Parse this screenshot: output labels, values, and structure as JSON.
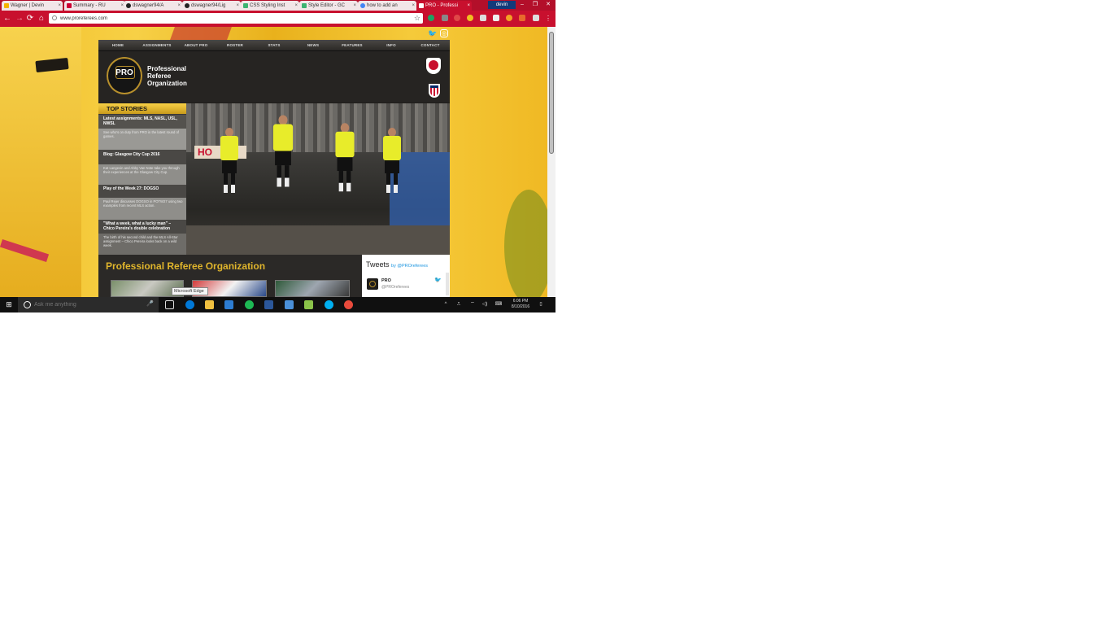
{
  "browser": {
    "tabs": [
      {
        "label": "Wagner | Devin",
        "favicon_color": "#f4b400",
        "active": false
      },
      {
        "label": "Summary - RU",
        "favicon_color": "#cc0033",
        "active": false
      },
      {
        "label": "dswagner94/A",
        "favicon_color": "#222222",
        "active": false
      },
      {
        "label": "dswagner94/Lig",
        "favicon_color": "#222222",
        "active": false
      },
      {
        "label": "CSS Styling Inst",
        "favicon_color": "#3cb371",
        "active": false
      },
      {
        "label": "Style Editor - GC",
        "favicon_color": "#3cb371",
        "active": false
      },
      {
        "label": "how to add an",
        "favicon_color": "#4285f4",
        "active": false
      },
      {
        "label": "PRO - Professi",
        "favicon_color": "#c8102e",
        "active": true
      }
    ],
    "tab_close": "×",
    "profile_name": "devin",
    "window_buttons": [
      "–",
      "❐",
      "✕"
    ],
    "nav": {
      "back": "←",
      "forward": "→",
      "reload": "⟳",
      "home": "⌂"
    },
    "url": "www.proreferees.com",
    "bookmark_star": "☆",
    "extension_colors": [
      "#1ea362",
      "#888888",
      "#e04848",
      "#f0c020",
      "#dddddd",
      "#f4a024",
      "#e86a2c",
      "#888888",
      "#888888"
    ]
  },
  "site": {
    "social": {
      "twitter": "🐦",
      "instagram": "◎"
    },
    "nav": [
      "HOME",
      "ASSIGNMENTS",
      "ABOUT PRO",
      "ROSTER",
      "STATS",
      "NEWS",
      "FEATURES",
      "INFO",
      "CONTACT"
    ],
    "logo_text": "PRO",
    "name_lines": [
      "Professional",
      "Referee",
      "Organization"
    ],
    "top_stories_title": "TOP STORIES",
    "stories": [
      {
        "title": "Latest assignments: MLS, NASL, USL, NWSL",
        "desc": "See who's on duty from PRO in the latest round of games."
      },
      {
        "title": "Blog: Glasgow City Cup 2016",
        "desc": ""
      },
      {
        "title": "",
        "desc": "Kat Langevin and Abby Van Note take you through their experiences at the Glasgow City Cup."
      },
      {
        "title": "Play of the Week 27: DOGSO",
        "desc": ""
      },
      {
        "title": "",
        "desc": "Paul Rejer discusses DOGSO in POTW27 using two examples from recent MLS action."
      },
      {
        "title": "\"What a week, what a lucky man\" – Chico Pereira's double celebration",
        "desc": "The birth of his second child and the MLS All-Star assignment – Chico Pereira looks back on a wild week."
      }
    ],
    "hero_sign": "HO",
    "about_title": "Professional Referee Organization",
    "tooltip": "Microsoft Edge",
    "tweets": {
      "title": "Tweets",
      "by": "by @PROreferees",
      "name": "PRO",
      "handle": "@PROreferees"
    }
  },
  "taskbar": {
    "start": "⊞",
    "search_placeholder": "Ask me anything",
    "mic": "🎤",
    "app_colors": [
      "#0078d7",
      "#f0c040",
      "#2d7dd2",
      "#1db954",
      "#2b579a",
      "#4a90d9",
      "#8bc34a",
      "#00aff0",
      "#e94b3c"
    ],
    "tray": [
      "^",
      "⎍",
      "⌔",
      "◁)",
      "⌨"
    ],
    "time": "6:06 PM",
    "date": "8/10/2016",
    "notifications": "▯"
  }
}
